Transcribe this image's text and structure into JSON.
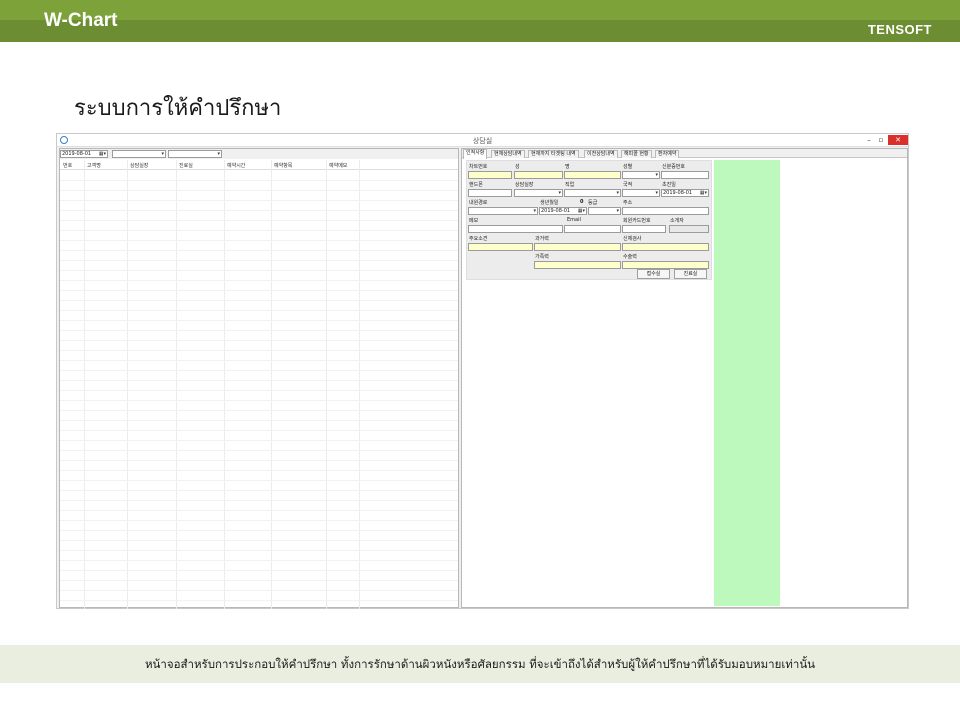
{
  "header": {
    "brand": "W-Chart",
    "company": "TENSOFT"
  },
  "page_title": "ระบบการให้คำปรึกษา",
  "window": {
    "title": "상담실",
    "minimize_label": "–",
    "maximize_label": "▫",
    "close_label": "✕"
  },
  "left_panel": {
    "date_value": "2019-08-01",
    "date_dropdown_glyph": "▦▾",
    "combo1_value": "",
    "combo2_value": "",
    "dropdown_glyph": "▾",
    "columns": [
      "번호",
      "고객명",
      "상담실장",
      "진료실",
      "예약시간",
      "예약항목",
      "예약메모"
    ]
  },
  "right_panel": {
    "tabs": [
      "인적사항",
      "현재상담내역",
      "현재까지 타겟팅 내역",
      "이전상담내역",
      "해피콜 현황",
      "환자예약"
    ],
    "active_tab": 0,
    "form": {
      "labels": {
        "chart_no": "차트번호",
        "last_name": "성",
        "first_name": "명",
        "gender": "성별",
        "resident_no": "신분증번호",
        "mobile": "핸드폰",
        "consult_manager": "상담실장",
        "job": "직업",
        "nationality": "국적",
        "first_visit": "초진일",
        "visit_route": "내원경로",
        "birth_date": "생년월일",
        "grade": "등급",
        "address": "주소",
        "memo": "메모",
        "email": "Email",
        "member_card": "회원카드번호",
        "referrer": "소개자",
        "chief_complaint": "주요소견",
        "past_history": "과거력",
        "physical_exam": "신체검사",
        "family_history": "가족력",
        "surgical_history": "수술력"
      },
      "values": {
        "first_visit": "2019-08-01",
        "birth_date": "2019-08-01",
        "grade_value": "0"
      },
      "buttons": {
        "reception": "접수실",
        "exam_room": "진료실"
      }
    }
  },
  "footer_text": "หน้าจอสำหรับการประกอบให้คำปรึกษา ทั้งการรักษาด้านผิวหนังหรือศัลยกรรม ที่จะเข้าถึงได้สำหรับผู้ให้คำปรึกษาที่ได้รับมอบหมายเท่านั้น",
  "colors": {
    "header_green": "#6d8d32",
    "footer_bg": "#eaeee0",
    "required_field": "#ffffcc",
    "side_panel": "#bdf8bd",
    "close_button": "#d9302c"
  }
}
